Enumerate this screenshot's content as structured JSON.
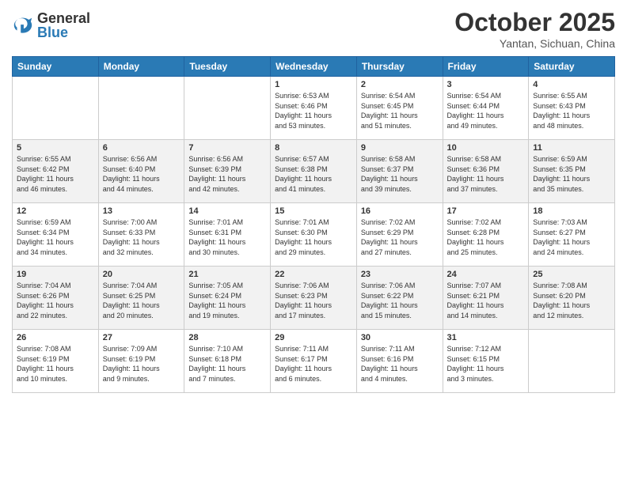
{
  "header": {
    "logo_general": "General",
    "logo_blue": "Blue",
    "month": "October 2025",
    "location": "Yantan, Sichuan, China"
  },
  "days_of_week": [
    "Sunday",
    "Monday",
    "Tuesday",
    "Wednesday",
    "Thursday",
    "Friday",
    "Saturday"
  ],
  "weeks": [
    [
      {
        "day": "",
        "info": ""
      },
      {
        "day": "",
        "info": ""
      },
      {
        "day": "",
        "info": ""
      },
      {
        "day": "1",
        "info": "Sunrise: 6:53 AM\nSunset: 6:46 PM\nDaylight: 11 hours\nand 53 minutes."
      },
      {
        "day": "2",
        "info": "Sunrise: 6:54 AM\nSunset: 6:45 PM\nDaylight: 11 hours\nand 51 minutes."
      },
      {
        "day": "3",
        "info": "Sunrise: 6:54 AM\nSunset: 6:44 PM\nDaylight: 11 hours\nand 49 minutes."
      },
      {
        "day": "4",
        "info": "Sunrise: 6:55 AM\nSunset: 6:43 PM\nDaylight: 11 hours\nand 48 minutes."
      }
    ],
    [
      {
        "day": "5",
        "info": "Sunrise: 6:55 AM\nSunset: 6:42 PM\nDaylight: 11 hours\nand 46 minutes."
      },
      {
        "day": "6",
        "info": "Sunrise: 6:56 AM\nSunset: 6:40 PM\nDaylight: 11 hours\nand 44 minutes."
      },
      {
        "day": "7",
        "info": "Sunrise: 6:56 AM\nSunset: 6:39 PM\nDaylight: 11 hours\nand 42 minutes."
      },
      {
        "day": "8",
        "info": "Sunrise: 6:57 AM\nSunset: 6:38 PM\nDaylight: 11 hours\nand 41 minutes."
      },
      {
        "day": "9",
        "info": "Sunrise: 6:58 AM\nSunset: 6:37 PM\nDaylight: 11 hours\nand 39 minutes."
      },
      {
        "day": "10",
        "info": "Sunrise: 6:58 AM\nSunset: 6:36 PM\nDaylight: 11 hours\nand 37 minutes."
      },
      {
        "day": "11",
        "info": "Sunrise: 6:59 AM\nSunset: 6:35 PM\nDaylight: 11 hours\nand 35 minutes."
      }
    ],
    [
      {
        "day": "12",
        "info": "Sunrise: 6:59 AM\nSunset: 6:34 PM\nDaylight: 11 hours\nand 34 minutes."
      },
      {
        "day": "13",
        "info": "Sunrise: 7:00 AM\nSunset: 6:33 PM\nDaylight: 11 hours\nand 32 minutes."
      },
      {
        "day": "14",
        "info": "Sunrise: 7:01 AM\nSunset: 6:31 PM\nDaylight: 11 hours\nand 30 minutes."
      },
      {
        "day": "15",
        "info": "Sunrise: 7:01 AM\nSunset: 6:30 PM\nDaylight: 11 hours\nand 29 minutes."
      },
      {
        "day": "16",
        "info": "Sunrise: 7:02 AM\nSunset: 6:29 PM\nDaylight: 11 hours\nand 27 minutes."
      },
      {
        "day": "17",
        "info": "Sunrise: 7:02 AM\nSunset: 6:28 PM\nDaylight: 11 hours\nand 25 minutes."
      },
      {
        "day": "18",
        "info": "Sunrise: 7:03 AM\nSunset: 6:27 PM\nDaylight: 11 hours\nand 24 minutes."
      }
    ],
    [
      {
        "day": "19",
        "info": "Sunrise: 7:04 AM\nSunset: 6:26 PM\nDaylight: 11 hours\nand 22 minutes."
      },
      {
        "day": "20",
        "info": "Sunrise: 7:04 AM\nSunset: 6:25 PM\nDaylight: 11 hours\nand 20 minutes."
      },
      {
        "day": "21",
        "info": "Sunrise: 7:05 AM\nSunset: 6:24 PM\nDaylight: 11 hours\nand 19 minutes."
      },
      {
        "day": "22",
        "info": "Sunrise: 7:06 AM\nSunset: 6:23 PM\nDaylight: 11 hours\nand 17 minutes."
      },
      {
        "day": "23",
        "info": "Sunrise: 7:06 AM\nSunset: 6:22 PM\nDaylight: 11 hours\nand 15 minutes."
      },
      {
        "day": "24",
        "info": "Sunrise: 7:07 AM\nSunset: 6:21 PM\nDaylight: 11 hours\nand 14 minutes."
      },
      {
        "day": "25",
        "info": "Sunrise: 7:08 AM\nSunset: 6:20 PM\nDaylight: 11 hours\nand 12 minutes."
      }
    ],
    [
      {
        "day": "26",
        "info": "Sunrise: 7:08 AM\nSunset: 6:19 PM\nDaylight: 11 hours\nand 10 minutes."
      },
      {
        "day": "27",
        "info": "Sunrise: 7:09 AM\nSunset: 6:19 PM\nDaylight: 11 hours\nand 9 minutes."
      },
      {
        "day": "28",
        "info": "Sunrise: 7:10 AM\nSunset: 6:18 PM\nDaylight: 11 hours\nand 7 minutes."
      },
      {
        "day": "29",
        "info": "Sunrise: 7:11 AM\nSunset: 6:17 PM\nDaylight: 11 hours\nand 6 minutes."
      },
      {
        "day": "30",
        "info": "Sunrise: 7:11 AM\nSunset: 6:16 PM\nDaylight: 11 hours\nand 4 minutes."
      },
      {
        "day": "31",
        "info": "Sunrise: 7:12 AM\nSunset: 6:15 PM\nDaylight: 11 hours\nand 3 minutes."
      },
      {
        "day": "",
        "info": ""
      }
    ]
  ]
}
